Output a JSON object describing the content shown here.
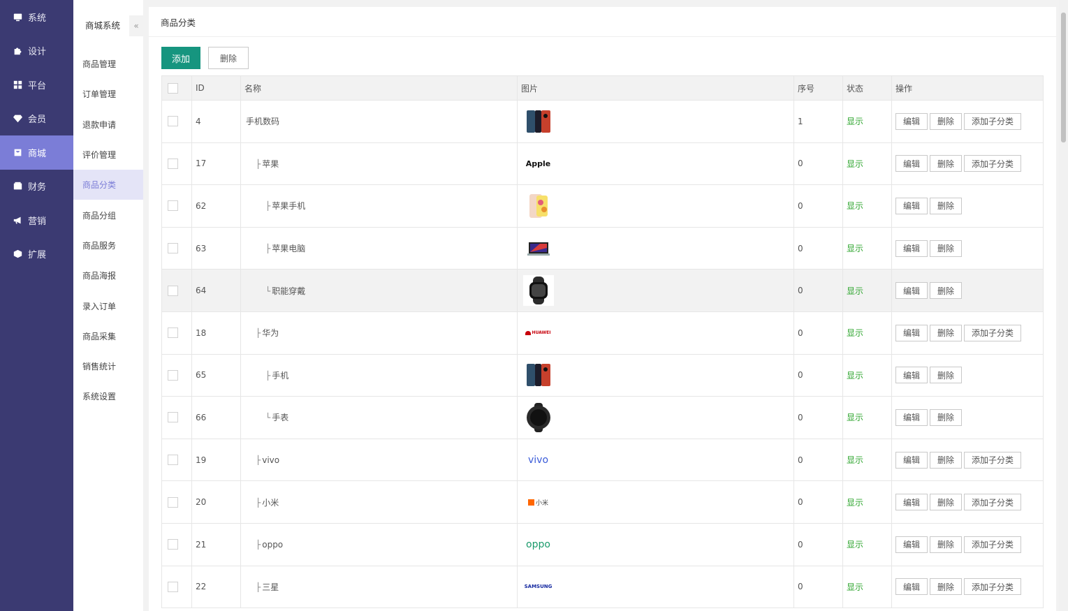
{
  "sidebar": {
    "items": [
      {
        "label": "系统",
        "icon": "monitor-icon"
      },
      {
        "label": "设计",
        "icon": "puzzle-icon"
      },
      {
        "label": "平台",
        "icon": "grid-icon"
      },
      {
        "label": "会员",
        "icon": "diamond-icon"
      },
      {
        "label": "商城",
        "icon": "shop-icon"
      },
      {
        "label": "财务",
        "icon": "wallet-icon"
      },
      {
        "label": "营销",
        "icon": "megaphone-icon"
      },
      {
        "label": "扩展",
        "icon": "cube-icon"
      }
    ],
    "active_index": 4
  },
  "subnav": {
    "title": "商城系统",
    "collapse_glyph": "«",
    "items": [
      "商品管理",
      "订单管理",
      "退款申请",
      "评价管理",
      "商品分类",
      "商品分组",
      "商品服务",
      "商品海报",
      "录入订单",
      "商品采集",
      "销售统计",
      "系统设置"
    ],
    "active_index": 4
  },
  "page": {
    "title": "商品分类",
    "add_label": "添加",
    "delete_label": "删除"
  },
  "table": {
    "headers": {
      "id": "ID",
      "name": "名称",
      "image": "图片",
      "sort": "序号",
      "status": "状态",
      "ops": "操作"
    },
    "op_labels": {
      "edit": "编辑",
      "delete": "删除",
      "add_child": "添加子分类"
    },
    "rows": [
      {
        "id": "4",
        "name": "手机数码",
        "prefix": "",
        "indent": 0,
        "image": "phones",
        "sort": "1",
        "status": "显示",
        "add_child": true
      },
      {
        "id": "17",
        "name": "苹果",
        "prefix": "├",
        "indent": 1,
        "image": "apple-text",
        "image_text": "Apple",
        "sort": "0",
        "status": "显示",
        "add_child": true
      },
      {
        "id": "62",
        "name": "苹果手机",
        "prefix": "├",
        "indent": 2,
        "image": "iphone",
        "sort": "0",
        "status": "显示",
        "add_child": false
      },
      {
        "id": "63",
        "name": "苹果电脑",
        "prefix": "├",
        "indent": 2,
        "image": "macbook",
        "sort": "0",
        "status": "显示",
        "add_child": false
      },
      {
        "id": "64",
        "name": "职能穿戴",
        "prefix": "└",
        "indent": 2,
        "image": "watch",
        "sort": "0",
        "status": "显示",
        "add_child": false
      },
      {
        "id": "18",
        "name": "华为",
        "prefix": "├",
        "indent": 1,
        "image": "huawei",
        "image_text": "HUAWEI",
        "sort": "0",
        "status": "显示",
        "add_child": true
      },
      {
        "id": "65",
        "name": "手机",
        "prefix": "├",
        "indent": 2,
        "image": "phones",
        "sort": "0",
        "status": "显示",
        "add_child": false
      },
      {
        "id": "66",
        "name": "手表",
        "prefix": "└",
        "indent": 2,
        "image": "round-watch",
        "sort": "0",
        "status": "显示",
        "add_child": false
      },
      {
        "id": "19",
        "name": "vivo",
        "prefix": "├",
        "indent": 1,
        "image": "vivo",
        "image_text": "vivo",
        "sort": "0",
        "status": "显示",
        "add_child": true
      },
      {
        "id": "20",
        "name": "小米",
        "prefix": "├",
        "indent": 1,
        "image": "xiaomi",
        "image_text": "小米",
        "sort": "0",
        "status": "显示",
        "add_child": true
      },
      {
        "id": "21",
        "name": "oppo",
        "prefix": "├",
        "indent": 1,
        "image": "oppo",
        "image_text": "oppo",
        "sort": "0",
        "status": "显示",
        "add_child": true
      },
      {
        "id": "22",
        "name": "三星",
        "prefix": "├",
        "indent": 1,
        "image": "samsung",
        "image_text": "SAMSUNG",
        "sort": "0",
        "status": "显示",
        "add_child": true
      }
    ],
    "hover_row_index": 4
  },
  "colors": {
    "sidebar_bg": "#3b3a72",
    "sidebar_active": "#7b7dd7",
    "add_button": "#16957f",
    "status_green": "#2fa62f"
  }
}
